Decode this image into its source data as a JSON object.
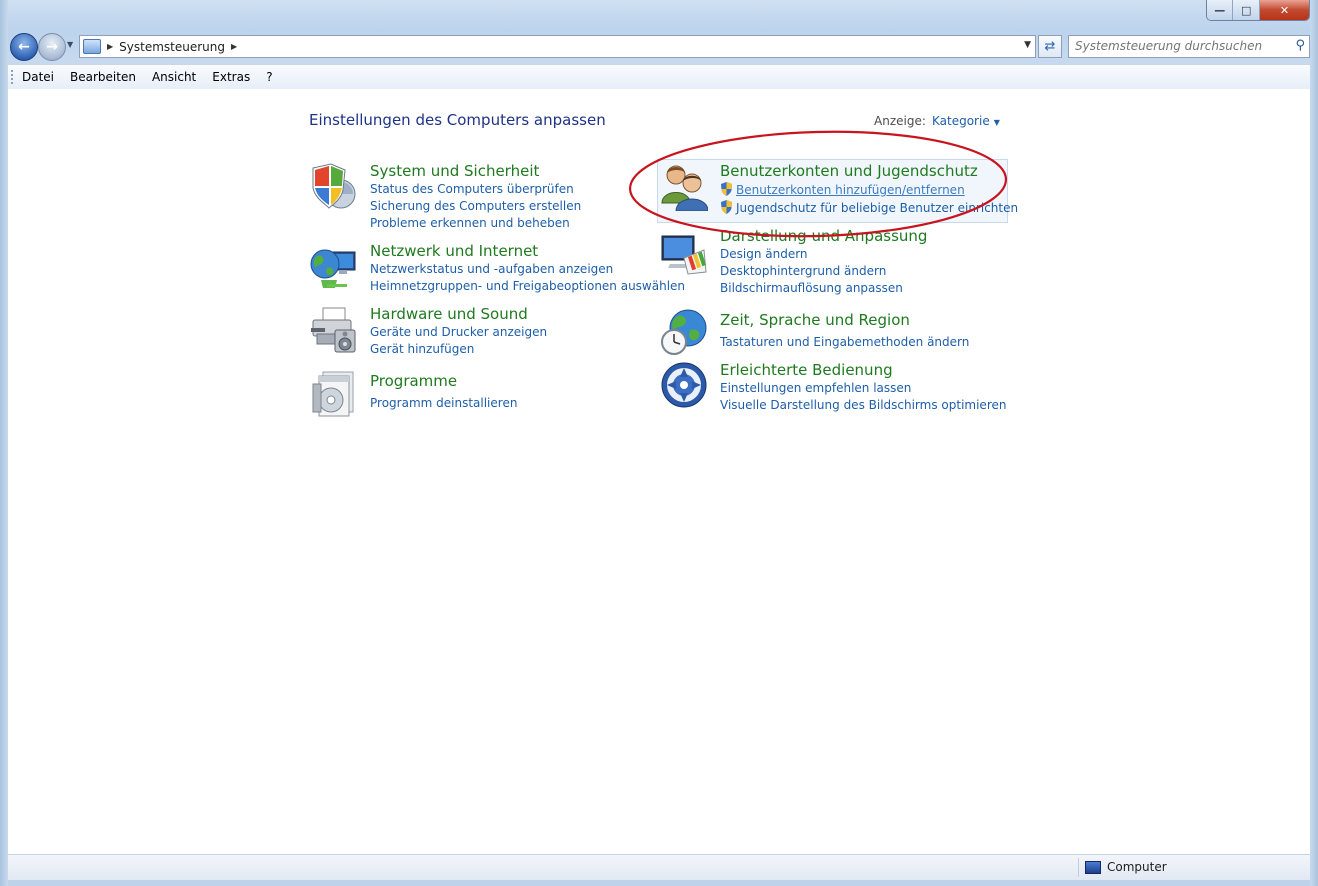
{
  "address": {
    "crumb": "Systemsteuerung"
  },
  "search": {
    "placeholder": "Systemsteuerung durchsuchen"
  },
  "menu": {
    "items": [
      "Datei",
      "Bearbeiten",
      "Ansicht",
      "Extras",
      "?"
    ]
  },
  "page": {
    "title": "Einstellungen des Computers anpassen",
    "view_label": "Anzeige:",
    "view_value": "Kategorie"
  },
  "categories": {
    "system": {
      "title": "System und Sicherheit",
      "links": [
        "Status des Computers überprüfen",
        "Sicherung des Computers erstellen",
        "Probleme erkennen und beheben"
      ],
      "icon": "shield-icon"
    },
    "network": {
      "title": "Netzwerk und Internet",
      "links": [
        "Netzwerkstatus und -aufgaben anzeigen",
        "Heimnetzgruppen- und Freigabeoptionen auswählen"
      ],
      "icon": "globe-network-icon"
    },
    "hardware": {
      "title": "Hardware und Sound",
      "links": [
        "Geräte und Drucker anzeigen",
        "Gerät hinzufügen"
      ],
      "icon": "printer-icon"
    },
    "programs": {
      "title": "Programme",
      "links": [
        "Programm deinstallieren"
      ],
      "icon": "programs-icon"
    },
    "users": {
      "title": "Benutzerkonten und Jugendschutz",
      "links": [
        "Benutzerkonten hinzufügen/entfernen",
        "Jugendschutz für beliebige Benutzer einrichten"
      ],
      "icon": "users-icon"
    },
    "appearance": {
      "title": "Darstellung und Anpassung",
      "links": [
        "Design ändern",
        "Desktophintergrund ändern",
        "Bildschirmauflösung anpassen"
      ],
      "icon": "monitor-palette-icon"
    },
    "clock": {
      "title": "Zeit, Sprache und Region",
      "links": [
        "Tastaturen und Eingabemethoden ändern"
      ],
      "icon": "clock-globe-icon"
    },
    "ease": {
      "title": "Erleichterte Bedienung",
      "links": [
        "Einstellungen empfehlen lassen",
        "Visuelle Darstellung des Bildschirms optimieren"
      ],
      "icon": "ease-of-access-icon"
    }
  },
  "status": {
    "computer": "Computer"
  },
  "colors": {
    "link": "#1e5ea8",
    "category": "#1f7a1f",
    "title": "#1e3287",
    "annotation": "#c8141e"
  }
}
